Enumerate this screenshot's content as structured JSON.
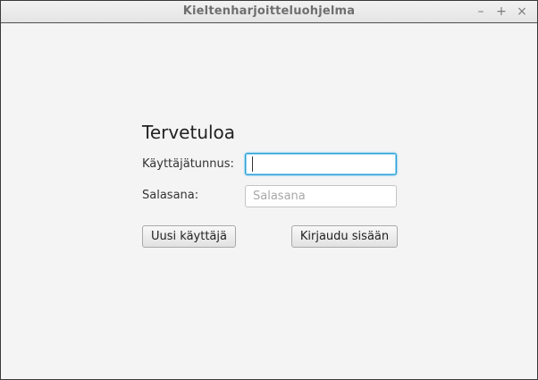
{
  "window": {
    "title": "Kieltenharjoitteluohjelma",
    "controls": {
      "minimize": "–",
      "maximize": "+",
      "close": "×"
    }
  },
  "login": {
    "heading": "Tervetuloa",
    "username_label": "Käyttäjätunnus:",
    "username_value": "",
    "password_label": "Salasana:",
    "password_placeholder": "Salasana",
    "new_user_button": "Uusi käyttäjä",
    "login_button": "Kirjaudu sisään"
  },
  "colors": {
    "focus_border": "#2f9fd6",
    "background": "#f4f4f4"
  },
  "icons": {
    "minimize": "minimize-icon",
    "maximize": "maximize-icon",
    "close": "close-icon"
  }
}
